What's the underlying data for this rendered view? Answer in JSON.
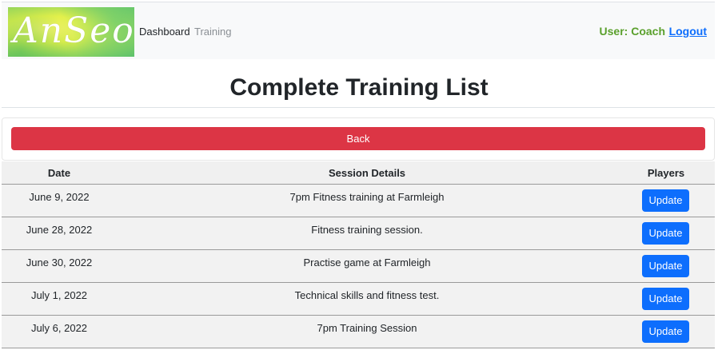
{
  "navbar": {
    "logo_text": "AnSeo",
    "links": {
      "dashboard": "Dashboard",
      "training": "Training"
    },
    "user_label": "User: Coach",
    "logout_label": "Logout"
  },
  "page": {
    "title": "Complete Training List",
    "back_label": "Back"
  },
  "table": {
    "headers": {
      "date": "Date",
      "details": "Session Details",
      "players": "Players"
    },
    "rows": [
      {
        "date": "June 9, 2022",
        "details": "7pm Fitness training at Farmleigh",
        "action": "Update"
      },
      {
        "date": "June 28, 2022",
        "details": "Fitness training session.",
        "action": "Update"
      },
      {
        "date": "June 30, 2022",
        "details": "Practise game at Farmleigh",
        "action": "Update"
      },
      {
        "date": "July 1, 2022",
        "details": "Technical skills and fitness test.",
        "action": "Update"
      },
      {
        "date": "July 6, 2022",
        "details": "7pm Training Session",
        "action": "Update"
      }
    ]
  },
  "colors": {
    "back_button": "#dc3545",
    "update_button": "#0d6efd",
    "user_label": "#5aa02c",
    "logout_link": "#0d6efd"
  }
}
